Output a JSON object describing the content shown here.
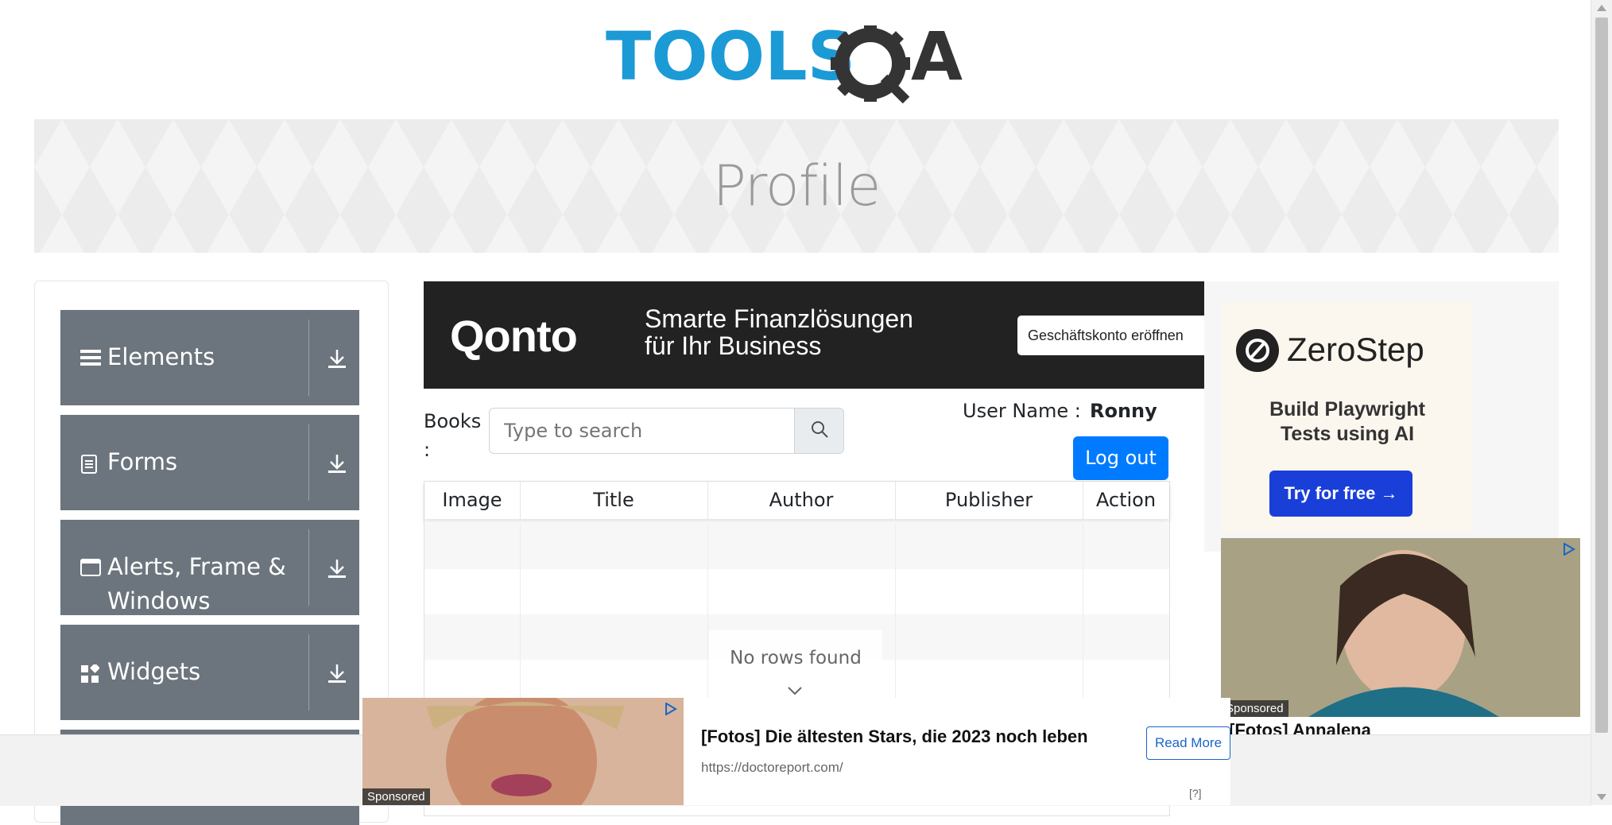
{
  "logo": {
    "text_left": "TOOLS",
    "text_right": "A"
  },
  "banner": {
    "title": "Profile"
  },
  "sidebar": {
    "groups": [
      {
        "label": "Elements",
        "icon": "list-icon"
      },
      {
        "label": "Forms",
        "icon": "document-icon"
      },
      {
        "label": "Alerts, Frame &",
        "label_line2": "Windows",
        "icon": "window-icon"
      },
      {
        "label": "Widgets",
        "icon": "widgets-icon"
      }
    ]
  },
  "ads": {
    "top": {
      "brand": "Qonto",
      "tagline1": "Smarte Finanzlösungen",
      "tagline2": "für Ihr Business",
      "cta": "Geschäftskonto eröffnen"
    },
    "right": {
      "brand": "ZeroStep",
      "headline1": "Build Playwright",
      "headline2": "Tests using AI",
      "cta": "Try for free →"
    },
    "right_photo": {
      "sponsored": "Sponsored",
      "title": "[Fotos] Annalena"
    },
    "bottom": {
      "sponsored": "Sponsored",
      "title": "[Fotos] Die ältesten Stars, die 2023 noch leben",
      "url": "https://doctoreport.com/",
      "cta": "Read More",
      "help": "[?]"
    }
  },
  "books": {
    "label": "Books :",
    "search_placeholder": "Type to search",
    "username_label": "User Name :",
    "username": "Ronny",
    "logout": "Log out",
    "columns": [
      "Image",
      "Title",
      "Author",
      "Publisher",
      "Action"
    ],
    "empty_message": "No rows found"
  },
  "colors": {
    "sidebar": "#6c757d",
    "primary": "#007bff",
    "logo_blue": "#1c9ad6",
    "logo_dark": "#343434"
  }
}
